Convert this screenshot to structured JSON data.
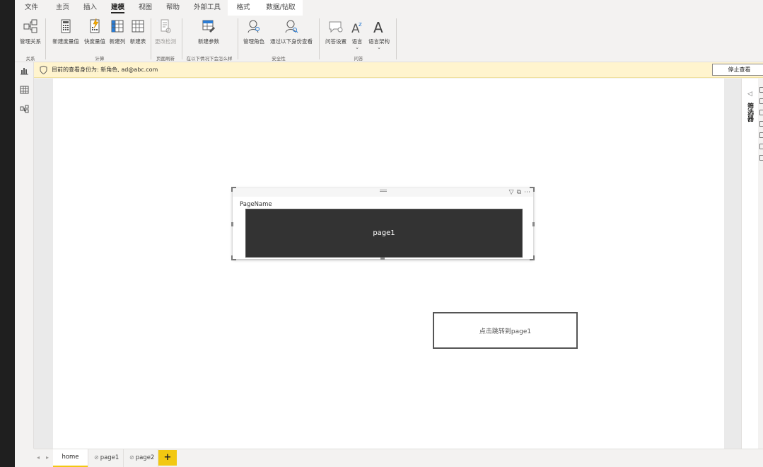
{
  "menu": {
    "tabs": [
      {
        "label": "文件"
      },
      {
        "label": "主页"
      },
      {
        "label": "插入"
      },
      {
        "label": "建模"
      },
      {
        "label": "视图"
      },
      {
        "label": "帮助"
      },
      {
        "label": "外部工具"
      },
      {
        "label": "格式"
      },
      {
        "label": "数据/钻取"
      }
    ],
    "active_tab": "建模"
  },
  "ribbon": {
    "manage_relationships": "管理关系",
    "new_measure": "新建度量值",
    "quick_measure": "快度量值",
    "new_column": "新建列",
    "new_table": "新建表",
    "change_detection": "更改检测",
    "new_parameter": "新建参数",
    "manage_roles": "管理角色",
    "view_as": "通过以下身份查看",
    "qa_setup": "问答设置",
    "language": "语言",
    "linguistic_schema": "语言架构",
    "groups": {
      "relationships": "关系",
      "calculations": "计算",
      "page_refresh": "页面刷新",
      "what_if": "在以下情况下会怎么样",
      "security": "安全性",
      "qa": "问答"
    }
  },
  "banner": {
    "text": "目前的查看身份为: 新角色, ad@abc.com",
    "stop_label": "停止查看"
  },
  "card_visual": {
    "title": "PageName",
    "value": "page1"
  },
  "jump_button": {
    "label": "点击跳转到page1"
  },
  "filter_pane": {
    "label": "筛选器"
  },
  "page_tabs": {
    "items": [
      {
        "label": "home"
      },
      {
        "label": "page1"
      },
      {
        "label": "page2"
      }
    ],
    "active": "home",
    "add_label": "+"
  },
  "colors": {
    "accent": "#f2c811",
    "banner_bg": "#fff4ce",
    "card_bg": "#333333"
  }
}
